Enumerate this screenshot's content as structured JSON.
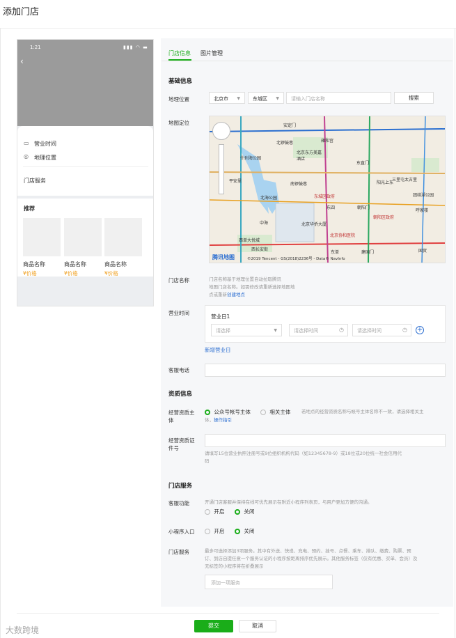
{
  "page": {
    "title": "添加门店"
  },
  "phone": {
    "time": "1:21",
    "status_icons": "▮▮▮ ◠ ▬",
    "rows": [
      {
        "icon": "store-icon",
        "glyph": "▭",
        "label": "营业时间"
      },
      {
        "icon": "location-pin-icon",
        "glyph": "◎",
        "label": "地理位置"
      }
    ],
    "service_title": "门店服务",
    "recommend_title": "推荐",
    "products": [
      {
        "name": "商品名称",
        "price": "¥价格"
      },
      {
        "name": "商品名称",
        "price": "¥价格"
      },
      {
        "name": "商品名称",
        "price": "¥价格"
      }
    ]
  },
  "tabs": [
    {
      "label": "门店信息",
      "active": true
    },
    {
      "label": "图片管理",
      "active": false
    }
  ],
  "basic": {
    "title": "基础信息",
    "geo_label": "地理位置",
    "city": "北京市",
    "district": "东城区",
    "search_placeholder": "请输入门店名称",
    "search_button": "搜索",
    "map_label": "地图定位",
    "map_labels": {
      "a": "安定门",
      "b": "北锣鼓巷",
      "c": "什刹海公园",
      "d": "雍和宫",
      "e": "北京东方美嘉酒店",
      "f": "东直门",
      "g": "平安里",
      "h": "南锣鼓巷",
      "i": "北海公园",
      "j": "东城区政府",
      "k": "东四",
      "l": "朝阳门",
      "m": "北京华侨大厦",
      "n": "北京协和医院",
      "o": "西单大悦城",
      "p": "西长安街",
      "q": "中海",
      "r": "东单",
      "s": "建国门",
      "t": "朝阳区政府",
      "u": "国贸",
      "v": "三里屯太古里",
      "w": "团结湖公园",
      "x": "呼家楼",
      "y": "阳光上东"
    },
    "map_brand": "腾讯地图",
    "map_copyright": "©2019 Tencent - GS(2018)2236号 - Data© NavInfo",
    "store_name_label": "门店名称",
    "store_name_hint_1": "门店名称基于地理位置自动拉取腾讯",
    "store_name_hint_2": "地图门店名称。如需修改请重新选择地图地",
    "store_name_hint_3_prefix": "点或重新",
    "store_name_hint_3_link": "创建地点",
    "hours_label": "营业时间",
    "hours_day": "营业日1",
    "hours_select": "请选择",
    "hours_start": "请选择时间",
    "hours_end": "请选择时间",
    "hours_add_link": "新增营业日",
    "phone_label": "客服电话"
  },
  "qual": {
    "title": "资质信息",
    "subject_label_1": "经营资质主",
    "subject_label_2": "体",
    "opt_mp": "公众号帐号主体",
    "opt_other": "相关主体",
    "subject_hint_1": "若地点的经营资质名称与帐号主体名称不一致，请选择相关主",
    "subject_hint_2_prefix": "体，",
    "subject_hint_2_link": "操作指引",
    "cert_label_1": "经营资质证",
    "cert_label_2": "件号",
    "cert_hint_1": "请填写15位营业执照注册号或9位组织机构代码（如12345678-9）或18位或20位统一社会信用代",
    "cert_hint_2": "码"
  },
  "services": {
    "title": "门店服务",
    "kf_label": "客服功能",
    "kf_hint": "开通门店客服并保持在线可优先展示在附近小程序列表页，与用户更加方便的沟通。",
    "mini_label": "小程序入口",
    "on": "开启",
    "off": "关闭",
    "svc_label": "门店服务",
    "svc_hint_1": "最多可选择添加3项服务。其中有外送、快递、充电、预约、挂号、点餐、乘车、排队、缴费、购票、预",
    "svc_hint_2": "订、到店自提任意一个服务认证的小程序按距离排序优先展示。其他服务标签（仅有优惠、买单、会员）及",
    "svc_hint_3": "无标签的小程序将在折叠展示",
    "svc_placeholder": "添加一项服务"
  },
  "footer": {
    "submit": "提交",
    "cancel": "取消"
  },
  "watermark": "大数跨境"
}
